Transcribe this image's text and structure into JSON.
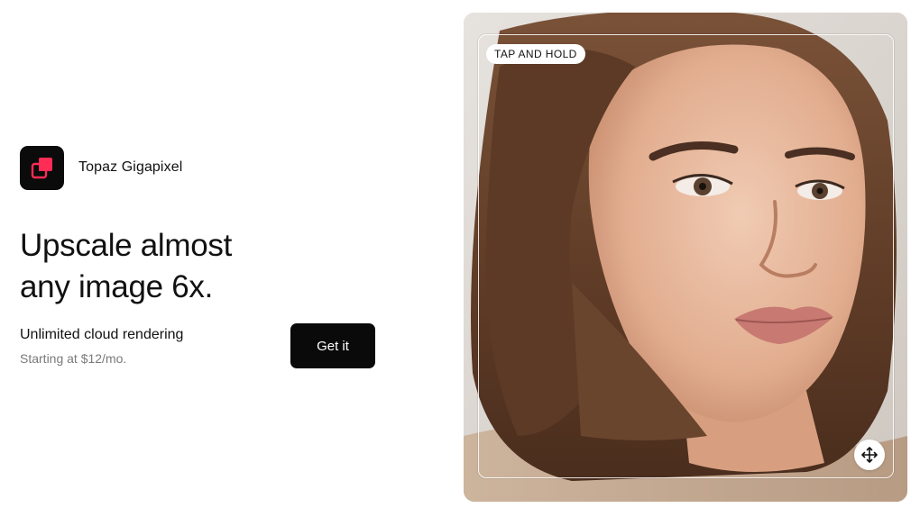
{
  "app": {
    "name": "Topaz Gigapixel",
    "icon": "gigapixel-logo-icon",
    "icon_bg": "#0b0b0b",
    "icon_accent": "#ff2d55"
  },
  "hero": {
    "headline_line1": "Upscale almost",
    "headline_line2": "any image 6x.",
    "tagline": "Unlimited cloud rendering",
    "price": "Starting at $12/mo.",
    "cta_label": "Get it"
  },
  "preview": {
    "badge": "TAP AND HOLD",
    "move_icon": "move-arrows-icon"
  }
}
